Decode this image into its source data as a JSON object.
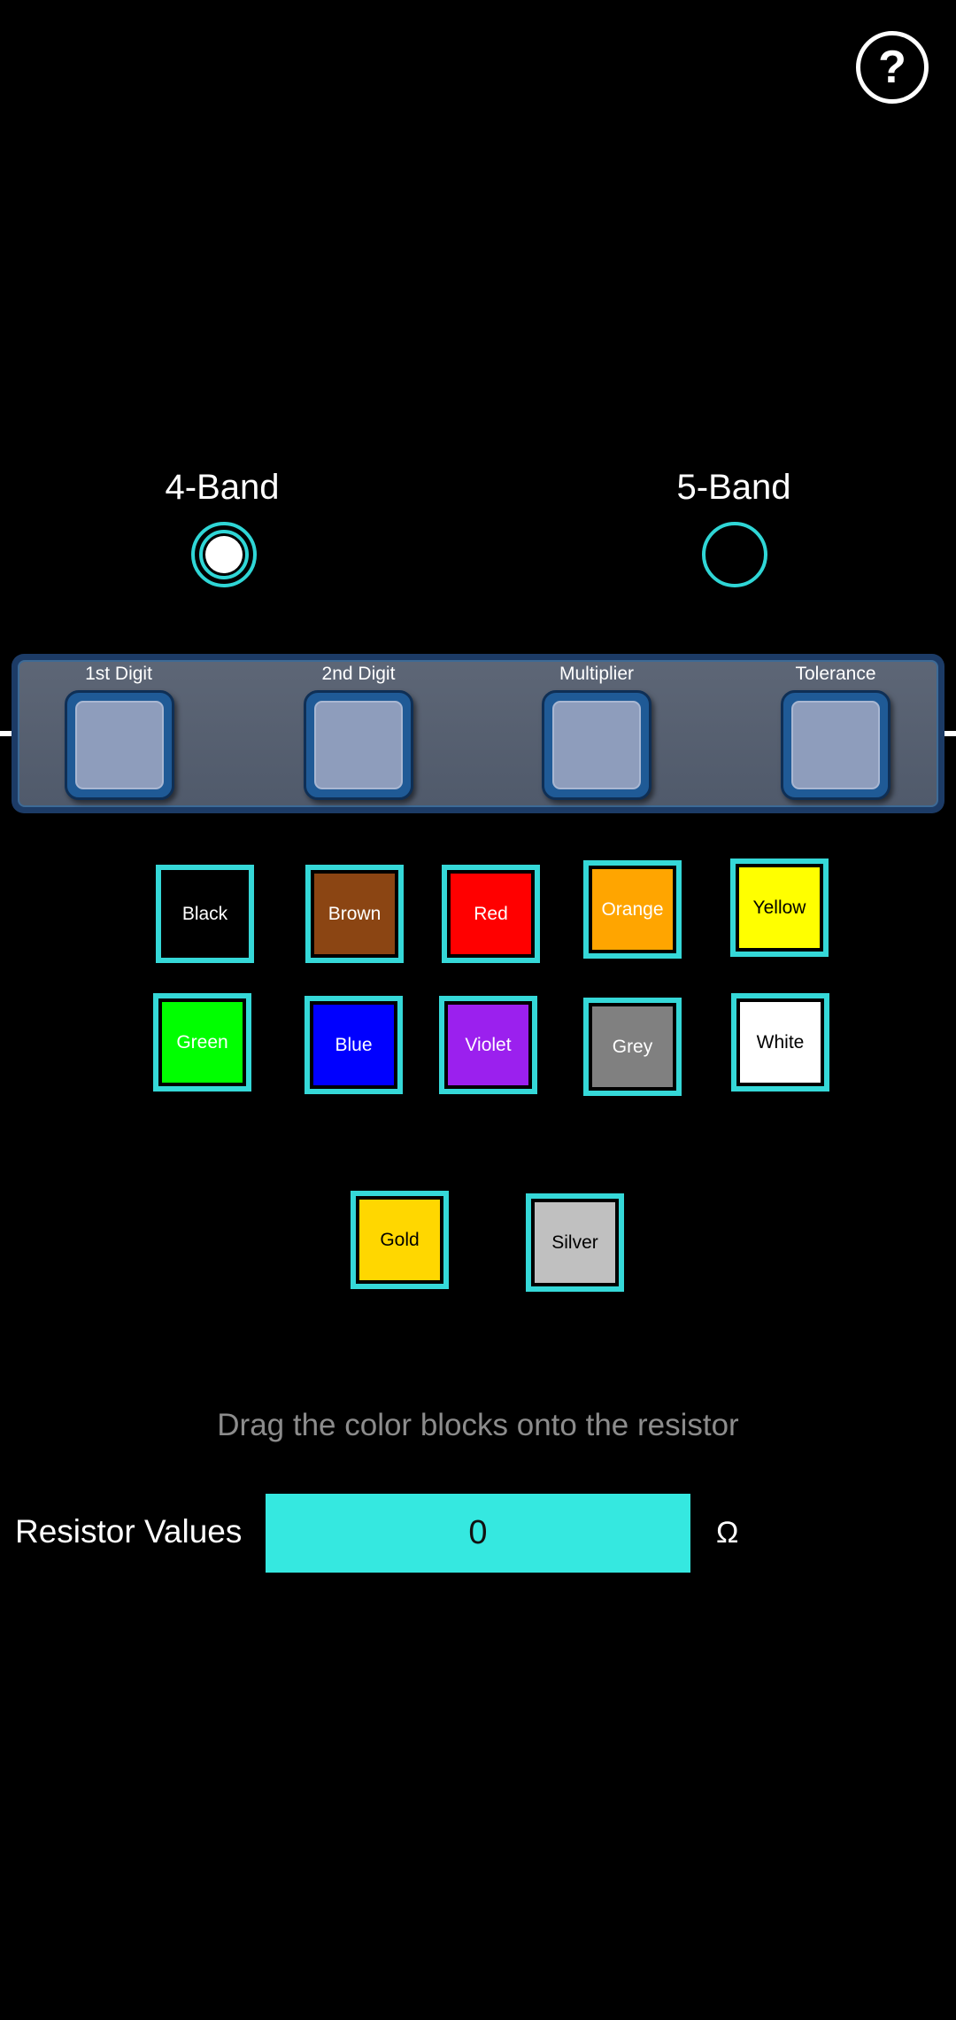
{
  "help": {
    "label": "?"
  },
  "bands": {
    "options": [
      {
        "label": "4-Band",
        "selected": true
      },
      {
        "label": "5-Band",
        "selected": false
      }
    ]
  },
  "resistor": {
    "slots": [
      {
        "label": "1st Digit"
      },
      {
        "label": "2nd Digit"
      },
      {
        "label": "Multiplier"
      },
      {
        "label": "Tolerance"
      }
    ]
  },
  "colors": [
    {
      "name": "Black",
      "color": "#000000",
      "text_color": "#ffffff"
    },
    {
      "name": "Brown",
      "color": "#8b4513",
      "text_color": "#ffffff"
    },
    {
      "name": "Red",
      "color": "#ff0000",
      "text_color": "#ffffff"
    },
    {
      "name": "Orange",
      "color": "#ffa500",
      "text_color": "#ffffff"
    },
    {
      "name": "Yellow",
      "color": "#ffff00",
      "text_color": "#000000"
    },
    {
      "name": "Green",
      "color": "#00ff00",
      "text_color": "#ffffff"
    },
    {
      "name": "Blue",
      "color": "#0000ff",
      "text_color": "#ffffff"
    },
    {
      "name": "Violet",
      "color": "#9b20ee",
      "text_color": "#ffffff"
    },
    {
      "name": "Grey",
      "color": "#808080",
      "text_color": "#ffffff"
    },
    {
      "name": "White",
      "color": "#ffffff",
      "text_color": "#000000"
    },
    {
      "name": "Gold",
      "color": "#ffd700",
      "text_color": "#000000"
    },
    {
      "name": "Silver",
      "color": "#c0c0c0",
      "text_color": "#000000"
    }
  ],
  "hint": "Drag the color blocks onto the resistor",
  "result": {
    "label": "Resistor Values",
    "value": "0",
    "unit": "Ω"
  },
  "theme": {
    "accent": "#35d8d8",
    "value_box": "#35e8e0"
  }
}
